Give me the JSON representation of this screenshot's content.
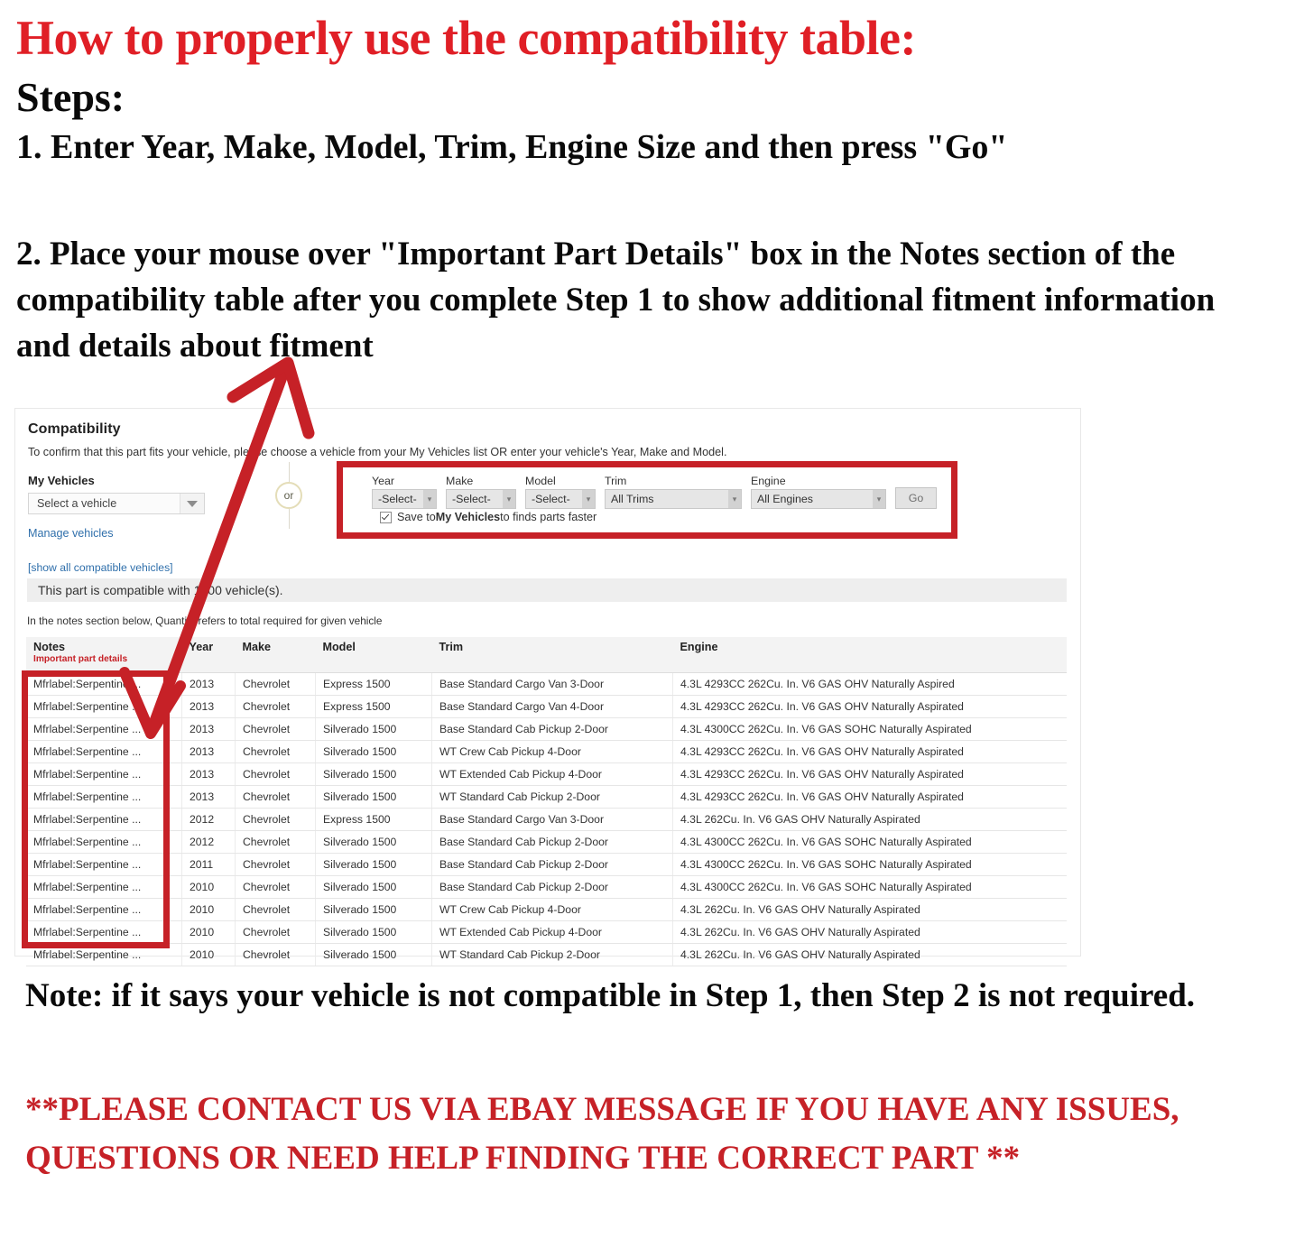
{
  "headline": {
    "title": "How to properly use the compatibility table:",
    "steps_label": "Steps:",
    "step1": "1. Enter Year, Make, Model, Trim, Engine Size and then press \"Go\"",
    "step2": "2. Place your mouse over \"Important Part Details\" box in the Notes section of the compatibility table after you complete Step 1 to show additional fitment information and details about fitment"
  },
  "colors": {
    "red_accent": "#c62127",
    "headline_red": "#e01f26",
    "link_blue": "#2f6fab"
  },
  "panel": {
    "title": "Compatibility",
    "subtitle": "To confirm that this part fits your vehicle, please choose a vehicle from your My Vehicles list OR enter your vehicle's Year, Make and Model.",
    "my_vehicles_label": "My Vehicles",
    "vehicle_select_value": "Select a vehicle",
    "manage_vehicles_link": "Manage vehicles",
    "show_all_link": "[show all compatible vehicles]",
    "or_divider": "or",
    "compat_banner": "This part is compatible with 1000 vehicle(s).",
    "notes_hint": "In the notes section below, Quantity refers to total required for given vehicle"
  },
  "search_form": {
    "fields": [
      {
        "label": "Year",
        "value": "-Select-"
      },
      {
        "label": "Make",
        "value": "-Select-"
      },
      {
        "label": "Model",
        "value": "-Select-"
      },
      {
        "label": "Trim",
        "value": "All Trims"
      },
      {
        "label": "Engine",
        "value": "All Engines"
      }
    ],
    "go_button": "Go",
    "save_checkbox": {
      "checked": true,
      "text_before": "Save to ",
      "text_bold": "My Vehicles",
      "text_after": " to finds parts faster"
    }
  },
  "table": {
    "headers": {
      "notes": "Notes",
      "notes_sub": "Important part details",
      "year": "Year",
      "make": "Make",
      "model": "Model",
      "trim": "Trim",
      "engine": "Engine"
    },
    "rows": [
      {
        "notes": "Mfrlabel:Serpentine ...",
        "year": "2013",
        "make": "Chevrolet",
        "model": "Express 1500",
        "trim": "Base Standard Cargo Van 3-Door",
        "engine": "4.3L 4293CC 262Cu. In. V6 GAS OHV Naturally Aspired"
      },
      {
        "notes": "Mfrlabel:Serpentine ...",
        "year": "2013",
        "make": "Chevrolet",
        "model": "Express 1500",
        "trim": "Base Standard Cargo Van 4-Door",
        "engine": "4.3L 4293CC 262Cu. In. V6 GAS OHV Naturally Aspirated"
      },
      {
        "notes": "Mfrlabel:Serpentine ...",
        "year": "2013",
        "make": "Chevrolet",
        "model": "Silverado 1500",
        "trim": "Base Standard Cab Pickup 2-Door",
        "engine": "4.3L 4300CC 262Cu. In. V6 GAS SOHC Naturally Aspirated"
      },
      {
        "notes": "Mfrlabel:Serpentine ...",
        "year": "2013",
        "make": "Chevrolet",
        "model": "Silverado 1500",
        "trim": "WT Crew Cab Pickup 4-Door",
        "engine": "4.3L 4293CC 262Cu. In. V6 GAS OHV Naturally Aspirated"
      },
      {
        "notes": "Mfrlabel:Serpentine ...",
        "year": "2013",
        "make": "Chevrolet",
        "model": "Silverado 1500",
        "trim": "WT Extended Cab Pickup 4-Door",
        "engine": "4.3L 4293CC 262Cu. In. V6 GAS OHV Naturally Aspirated"
      },
      {
        "notes": "Mfrlabel:Serpentine ...",
        "year": "2013",
        "make": "Chevrolet",
        "model": "Silverado 1500",
        "trim": "WT Standard Cab Pickup 2-Door",
        "engine": "4.3L 4293CC 262Cu. In. V6 GAS OHV Naturally Aspirated"
      },
      {
        "notes": "Mfrlabel:Serpentine ...",
        "year": "2012",
        "make": "Chevrolet",
        "model": "Express 1500",
        "trim": "Base Standard Cargo Van 3-Door",
        "engine": "4.3L 262Cu. In. V6 GAS OHV Naturally Aspirated"
      },
      {
        "notes": "Mfrlabel:Serpentine ...",
        "year": "2012",
        "make": "Chevrolet",
        "model": "Silverado 1500",
        "trim": "Base Standard Cab Pickup 2-Door",
        "engine": "4.3L 4300CC 262Cu. In. V6 GAS SOHC Naturally Aspirated"
      },
      {
        "notes": "Mfrlabel:Serpentine ...",
        "year": "2011",
        "make": "Chevrolet",
        "model": "Silverado 1500",
        "trim": "Base Standard Cab Pickup 2-Door",
        "engine": "4.3L 4300CC 262Cu. In. V6 GAS SOHC Naturally Aspirated"
      },
      {
        "notes": "Mfrlabel:Serpentine ...",
        "year": "2010",
        "make": "Chevrolet",
        "model": "Silverado 1500",
        "trim": "Base Standard Cab Pickup 2-Door",
        "engine": "4.3L 4300CC 262Cu. In. V6 GAS SOHC Naturally Aspirated"
      },
      {
        "notes": "Mfrlabel:Serpentine ...",
        "year": "2010",
        "make": "Chevrolet",
        "model": "Silverado 1500",
        "trim": "WT Crew Cab Pickup 4-Door",
        "engine": "4.3L 262Cu. In. V6 GAS OHV Naturally Aspirated"
      },
      {
        "notes": "Mfrlabel:Serpentine ...",
        "year": "2010",
        "make": "Chevrolet",
        "model": "Silverado 1500",
        "trim": "WT Extended Cab Pickup 4-Door",
        "engine": "4.3L 262Cu. In. V6 GAS OHV Naturally Aspirated"
      },
      {
        "notes": "Mfrlabel:Serpentine ...",
        "year": "2010",
        "make": "Chevrolet",
        "model": "Silverado 1500",
        "trim": "WT Standard Cab Pickup 2-Door",
        "engine": "4.3L 262Cu. In. V6 GAS OHV Naturally Aspirated"
      }
    ]
  },
  "footer": {
    "note": "Note: if it says your vehicle is not compatible in Step 1, then Step 2 is not required.",
    "contact": "**PLEASE CONTACT US VIA EBAY MESSAGE IF YOU HAVE ANY ISSUES, QUESTIONS OR NEED HELP FINDING THE CORRECT PART **"
  }
}
